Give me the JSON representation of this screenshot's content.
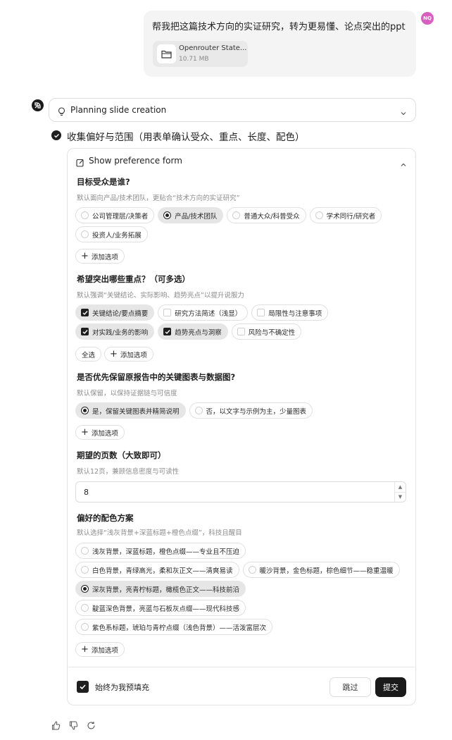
{
  "user": {
    "avatar_initials": "NQ",
    "message": "帮我把这篇技术方向的实证研究，转为更易懂、论点突出的ppt",
    "attachment": {
      "name": "Openrouter State...",
      "size": "10.71 MB"
    }
  },
  "assistant": {
    "planning_label": "Planning slide creation",
    "step_title": "收集偏好与范围（用表单确认受众、重点、长度、配色）",
    "form_header": "Show preference form"
  },
  "form": {
    "q1": {
      "title": "目标受众是谁?",
      "sub": "默认面向产品/技术团队，更贴合“技术方向的实证研究”",
      "options": [
        "公司管理层/决策者",
        "产品/技术团队",
        "普通大众/科普受众",
        "学术同行/研究者",
        "投资人/业务拓展"
      ],
      "selected": 1
    },
    "q2": {
      "title": "希望突出哪些重点？（可多选）",
      "sub": "默认强调“关键结论、实际影响、趋势亮点”以提升说服力",
      "options": [
        "关键结论/要点摘要",
        "研究方法简述（浅显）",
        "局限性与注意事项",
        "对实践/业务的影响",
        "趋势亮点与洞察",
        "风险与不确定性"
      ],
      "checked": [
        0,
        3,
        4
      ],
      "select_all": "全选"
    },
    "q3": {
      "title": "是否优先保留原报告中的关键图表与数据图?",
      "sub": "默认保留，以保持证据链与可信度",
      "options": [
        "是，保留关键图表并精简说明",
        "否，以文字与示例为主，少量图表"
      ],
      "selected": 0
    },
    "q4": {
      "title": "期望的页数（大致即可）",
      "sub": "默认12页，兼顾信息密度与可读性",
      "value": "8"
    },
    "q5": {
      "title": "偏好的配色方案",
      "sub": "默认选择“浅灰背景+深蓝标题+橙色点缀”，科技且醒目",
      "options": [
        "浅灰背景，深蓝标题，橙色点缀——专业且不压迫",
        "白色背景，青绿高光，柔和灰正文——清爽易读",
        "暖沙背景，金色标题，棕色细节——稳重温暖",
        "深灰背景，亮青柠标题，橄榄色正文——科技前沿",
        "靛蓝深色背景，亮蓝与石板灰点缀——现代科技感",
        "紫色系标题，琥珀与青柠点缀（浅色背景）——活泼富层次"
      ],
      "selected": 3
    },
    "add_option": "添加选项",
    "prefill_label": "始终为我预填充",
    "skip_label": "跳过",
    "submit_label": "提交"
  },
  "icons": {
    "bot_logo": "logo-icon",
    "planning": "lightbulb-icon",
    "form": "edit-form-icon",
    "footer": [
      "thumbs-up-icon",
      "thumbs-down-icon",
      "retry-icon"
    ]
  }
}
